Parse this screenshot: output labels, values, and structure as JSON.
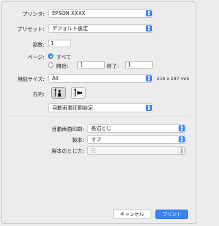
{
  "printer": {
    "label": "プリンタ:",
    "value": "EPSON XXXX"
  },
  "preset": {
    "label": "プリセット:",
    "value": "デフォルト設定"
  },
  "copies": {
    "label": "部数:",
    "value": "1"
  },
  "pages": {
    "label": "ページ:",
    "all_label": "すべて",
    "from_label": "開始:",
    "from_value": "1",
    "to_label": "終了:",
    "to_value": "1"
  },
  "paper": {
    "label": "用紙サイズ:",
    "value": "A4",
    "dims": "210 x 297 mm"
  },
  "orientation": {
    "label": "方向:"
  },
  "section": {
    "value": "自動両面印刷設定"
  },
  "duplex": {
    "label": "自動両面印刷:",
    "value": "長辺とじ"
  },
  "binding": {
    "label": "製本:",
    "value": "オフ"
  },
  "binding_edge": {
    "label": "製本のとじ方:",
    "value": "左"
  },
  "buttons": {
    "cancel": "キャンセル",
    "print": "プリント"
  },
  "colors": {
    "accent": "#3a7ff0"
  }
}
